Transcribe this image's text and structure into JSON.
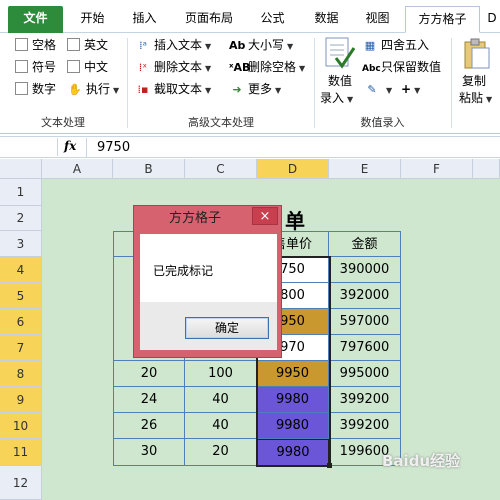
{
  "tabs": [
    "文件",
    "开始",
    "插入",
    "页面布局",
    "公式",
    "数据",
    "视图",
    "方方格子",
    "D"
  ],
  "ribbon": {
    "text_group": {
      "label": "文本处理",
      "checks": [
        "空格",
        "英文",
        "符号",
        "中文",
        "数字"
      ],
      "execute": "执行"
    },
    "adv_group": {
      "label": "高级文本处理",
      "items": [
        "插入文本",
        "删除文本",
        "截取文本",
        "大小写",
        "删除空格",
        "更多"
      ]
    },
    "num_group": {
      "label": "数值录入",
      "big_button_line1": "数值",
      "big_button_line2": "录入",
      "round": "四舍五入",
      "keep_value": "只保留数值",
      "plus": "+"
    },
    "copy_paste": {
      "line1": "复制",
      "line2": "粘贴"
    }
  },
  "formula_bar": {
    "fx": "fx",
    "value": "9750"
  },
  "columns": [
    "A",
    "B",
    "C",
    "D",
    "E",
    "F"
  ],
  "rows": [
    "1",
    "2",
    "3",
    "4",
    "5",
    "6",
    "7",
    "8",
    "9",
    "10",
    "11",
    "12"
  ],
  "sheet": {
    "title_char": "单",
    "header_d": "售单价",
    "header_e": "金额",
    "d_partial": [
      "750",
      "800",
      "950",
      "970"
    ],
    "e_values": [
      "390000",
      "392000",
      "597000",
      "797600",
      "995000",
      "399200",
      "399200",
      "199600"
    ],
    "lower_rows": [
      {
        "b": "20",
        "c": "100",
        "d": "9950"
      },
      {
        "b": "24",
        "c": "40",
        "d": "9980"
      },
      {
        "b": "26",
        "c": "40",
        "d": "9980"
      },
      {
        "b": "30",
        "c": "20",
        "d": "9980"
      }
    ]
  },
  "dialog": {
    "title": "方方格子",
    "close": "×",
    "message": "已完成标记",
    "ok": "确定"
  },
  "watermark": "Baidu经验",
  "colors": {
    "file_tab": "#2d8b3c",
    "gold": "#c9992f",
    "purple": "#6a56d6",
    "dialog": "#d6626f",
    "sheet_bg": "#cfe6cf"
  }
}
